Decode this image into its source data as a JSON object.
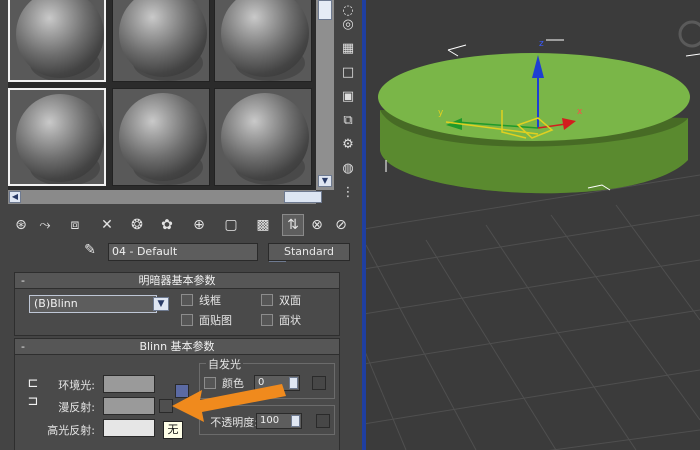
{
  "material_editor": {
    "name_value": "04 - Default",
    "type_label": "Standard",
    "shader_rollout": {
      "toggle": "-",
      "title": "明暗器基本参数",
      "shader_value": "(B)Blinn",
      "wire_label": "线框",
      "two_sided_label": "双面",
      "face_map_label": "面贴图",
      "faceted_label": "面状"
    },
    "blinn_rollout": {
      "toggle": "-",
      "title": "Blinn 基本参数",
      "ambient_label": "环境光:",
      "diffuse_label": "漫反射:",
      "specular_label": "高光反射:",
      "none_tooltip": "无",
      "self_illum_title": "自发光",
      "color_label": "颜色",
      "self_illum_value": "0",
      "opacity_label": "不透明度:",
      "opacity_value": "100",
      "colors": {
        "ambient": "#9a9a9a",
        "diffuse": "#9a9a9a",
        "specular": "#e6e6e6"
      }
    }
  },
  "viewport": {
    "object_color": "#7ab648",
    "gizmo_axes": {
      "x": "x",
      "y": "y",
      "z": "z"
    },
    "axis_colors": {
      "x": "#d21e1e",
      "y": "#1f9a2a",
      "z": "#1e3fd2"
    }
  },
  "annotation": {
    "arrow_color": "#f08a1d"
  }
}
